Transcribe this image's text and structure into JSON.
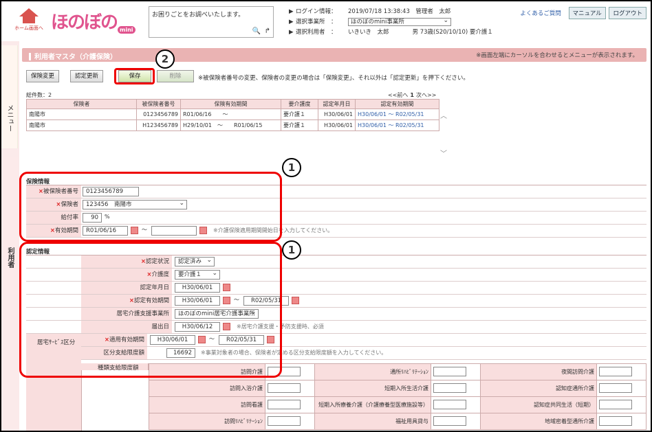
{
  "header": {
    "home_label": "ホーム画面へ",
    "logo_text": "ほのぼの",
    "logo_badge": "mini",
    "search_text": "お困りごとをお調べいたします。",
    "login_label": "ログイン情報：",
    "login_value": "2019/07/18 13:38:43　管理者　太郎",
    "office_label": "選択事業所　：",
    "office_value": "ほのぼのmini事業所",
    "user_label": "選択利用者　：",
    "user_value": "いきいき　太郎　　　　男 73歳(S20/10/10) 要介護１",
    "faq": "よくあるご質問",
    "manual": "マニュアル",
    "logout": "ログアウト"
  },
  "sidebar": {
    "menu_label": "メニュー",
    "user_label": "利用者"
  },
  "title": {
    "text": "利用者マスタ（介護保険）",
    "note": "※画面左端にカーソルを合わせるとメニューが表示されます。"
  },
  "actions": {
    "change": "保険変更",
    "renew": "認定更新",
    "save": "保存",
    "delete": "削除",
    "message": "※被保険者番号の変更、保険者の変更の場合は「保険変更」、それ以外は「認定更新」を押下ください。"
  },
  "badges": {
    "one": "1",
    "two": "2"
  },
  "list": {
    "count": "総件数：2",
    "prev": "<<前へ",
    "page": "1",
    "next": "次へ>>",
    "columns": [
      "保険者",
      "被保険者番号",
      "保険有効期間",
      "要介護度",
      "認定年月日",
      "認定有効期間"
    ],
    "rows": [
      [
        "南陽市",
        "0123456789",
        "R01/06/16　　～",
        "要介護１",
        "H30/06/01",
        "H30/06/01 ～ R02/05/31"
      ],
      [
        "南陽市",
        "H123456789",
        "H29/10/01　～　　R01/06/15",
        "要介護１",
        "H30/06/01",
        "H30/06/01 ～ R02/05/31"
      ]
    ]
  },
  "insurance": {
    "section": "保険情報",
    "number_label": "被保険者番号",
    "number_value": "0123456789",
    "insurer_label": "保険者",
    "insurer_value": "123456　南陽市",
    "rate_label": "給付率",
    "rate_value": "90",
    "rate_unit": "%",
    "period_label": "有効期間",
    "period_from": "R01/06/16",
    "period_tilde": "～",
    "period_hint": "※介護保険適用期間開始日を入力してください。"
  },
  "cert": {
    "section": "認定情報",
    "status_label": "認定状況",
    "status_value": "認定済み",
    "care_label": "介護度",
    "care_value": "要介護１",
    "date_label": "認定年月日",
    "date_value": "H30/06/01",
    "period_label": "認定有効期間",
    "period_from": "H30/06/01",
    "period_to": "R02/05/31",
    "support_label": "居宅介護支援事業所",
    "support_value": "ほのぼのmini居宅介護事業所",
    "notify_label": "届出日",
    "notify_value": "H30/06/12",
    "notify_hint": "※居宅介護支援・予防支援時、必須",
    "home_label": "居宅ｻｰﾋﾞｽ区分",
    "apply_label": "適用有効期間",
    "apply_from": "H30/06/01",
    "apply_to": "R02/05/31",
    "limit_label": "区分支給限度額",
    "limit_value": "16692",
    "limit_hint": "※事業対象者の場合、保険者が定める区分支給限度額を入力してください。",
    "kind_label": "種類支給限度額"
  },
  "services": [
    [
      "訪問介護",
      "通所ﾘﾊﾋﾞﾘﾃｰｼｮﾝ",
      "夜間訪問介護"
    ],
    [
      "訪問入浴介護",
      "短期入所生活介護",
      "認知症通所介護"
    ],
    [
      "訪問看護",
      "短期入所療養介護（介護療養型医療施設等）",
      "認知症共同生活（短期）"
    ],
    [
      "訪問ﾘﾊﾋﾞﾘﾃｰｼｮﾝ",
      "福祉用具貸与",
      "地域密着型通所介護"
    ]
  ]
}
